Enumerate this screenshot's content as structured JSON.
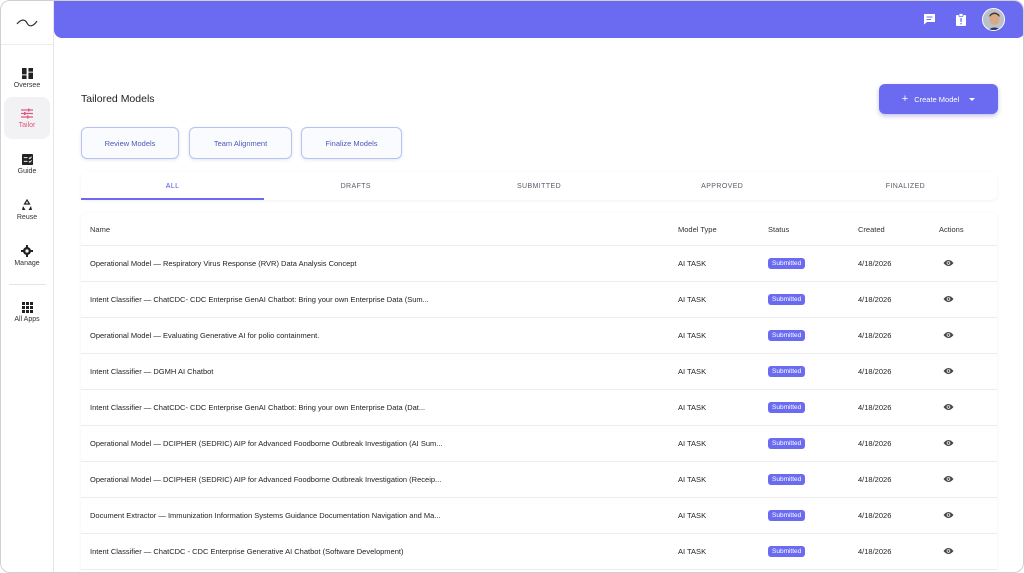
{
  "sidebar": {
    "items": [
      {
        "label": "Oversee",
        "icon": "dashboard-icon"
      },
      {
        "label": "Tailor",
        "icon": "tune-icon",
        "active": true
      },
      {
        "label": "Guide",
        "icon": "checklist-icon"
      },
      {
        "label": "Reuse",
        "icon": "recycle-icon"
      },
      {
        "label": "Manage",
        "icon": "gear-icon"
      },
      {
        "label": "All Apps",
        "icon": "grid-icon"
      }
    ]
  },
  "topbar": {
    "icons": [
      "chat-icon",
      "clipboard-alert-icon"
    ],
    "accent": "#6b6bf2"
  },
  "main": {
    "title": "Tailored Models",
    "create_label": "Create Model",
    "pills": [
      "Review Models",
      "Team Alignment",
      "Finalize Models"
    ],
    "tabs": [
      "ALL",
      "DRAFTS",
      "SUBMITTED",
      "APPROVED",
      "FINALIZED"
    ],
    "table": {
      "headers": {
        "name": "Name",
        "type": "Model Type",
        "status": "Status",
        "created": "Created",
        "actions": "Actions"
      },
      "rows": [
        {
          "name": "Operational Model — Respiratory Virus Response (RVR) Data Analysis Concept",
          "type": "AI TASK",
          "status": "Submitted",
          "created": "4/18/2026"
        },
        {
          "name": "Intent Classifier — ChatCDC- CDC Enterprise GenAI Chatbot: Bring your own Enterprise Data (Sum...",
          "type": "AI TASK",
          "status": "Submitted",
          "created": "4/18/2026"
        },
        {
          "name": "Operational Model — Evaluating Generative AI for polio containment.",
          "type": "AI TASK",
          "status": "Submitted",
          "created": "4/18/2026"
        },
        {
          "name": "Intent Classifier — DGMH AI Chatbot",
          "type": "AI TASK",
          "status": "Submitted",
          "created": "4/18/2026"
        },
        {
          "name": "Intent Classifier — ChatCDC- CDC Enterprise GenAI Chatbot: Bring your own Enterprise Data (Dat...",
          "type": "AI TASK",
          "status": "Submitted",
          "created": "4/18/2026"
        },
        {
          "name": "Operational Model — DCIPHER (SEDRIC) AIP for Advanced Foodborne Outbreak Investigation (AI Sum...",
          "type": "AI TASK",
          "status": "Submitted",
          "created": "4/18/2026"
        },
        {
          "name": "Operational Model — DCIPHER (SEDRIC) AIP for Advanced Foodborne Outbreak Investigation (Receip...",
          "type": "AI TASK",
          "status": "Submitted",
          "created": "4/18/2026"
        },
        {
          "name": "Document Extractor — Immunization Information Systems Guidance Documentation Navigation and Ma...",
          "type": "AI TASK",
          "status": "Submitted",
          "created": "4/18/2026"
        },
        {
          "name": "Intent Classifier — ChatCDC - CDC Enterprise Generative AI Chatbot (Software Development)",
          "type": "AI TASK",
          "status": "Submitted",
          "created": "4/18/2026"
        }
      ]
    }
  }
}
